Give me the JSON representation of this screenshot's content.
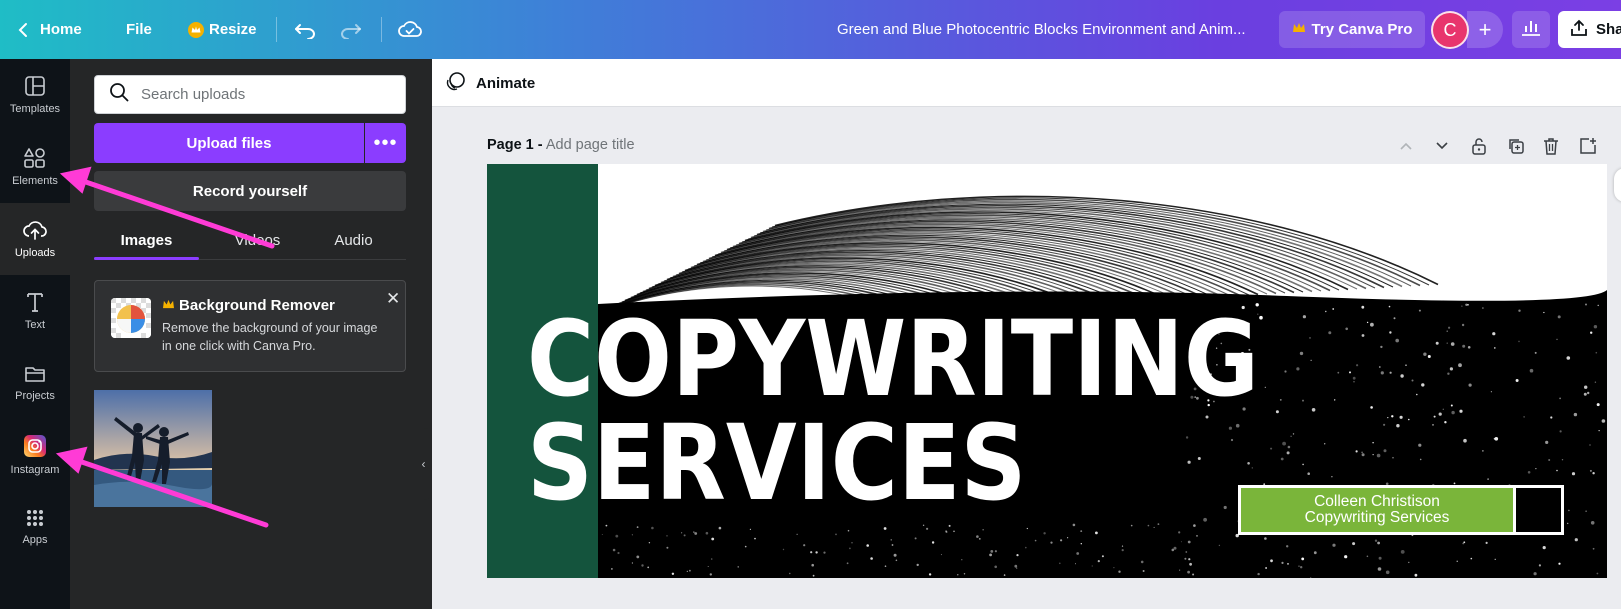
{
  "topbar": {
    "home_label": "Home",
    "file_label": "File",
    "resize_label": "Resize",
    "doc_title": "Green and Blue Photocentric Blocks Environment and Anim...",
    "try_pro_label": "Try Canva Pro",
    "avatar_initial": "C",
    "share_label": "Sha",
    "crown_color": "#f5b100"
  },
  "rail": {
    "items": [
      {
        "label": "Templates",
        "icon": "templates-icon"
      },
      {
        "label": "Elements",
        "icon": "elements-icon"
      },
      {
        "label": "Uploads",
        "icon": "upload-cloud-icon"
      },
      {
        "label": "Text",
        "icon": "text-icon"
      },
      {
        "label": "Projects",
        "icon": "folder-icon"
      },
      {
        "label": "Instagram",
        "icon": "instagram-icon"
      },
      {
        "label": "Apps",
        "icon": "apps-grid-icon"
      }
    ],
    "active_index": 2
  },
  "panel": {
    "search_placeholder": "Search uploads",
    "upload_label": "Upload files",
    "record_label": "Record yourself",
    "tabs": [
      {
        "label": "Images",
        "active": true
      },
      {
        "label": "Videos",
        "active": false
      },
      {
        "label": "Audio",
        "active": false
      }
    ],
    "promo": {
      "title": "Background Remover",
      "description": "Remove the background of your image in one click with Canva Pro."
    }
  },
  "editor": {
    "animate_label": "Animate",
    "page_label": "Page 1 -",
    "page_title_placeholder": "Add page title"
  },
  "design": {
    "headline_line1": "COPYWRITING",
    "headline_line2": "SERVICES",
    "name_line1": "Colleen Christison",
    "name_line2": "Copywriting Services",
    "green_band_color": "#14543d",
    "name_box_color": "#7ab53a"
  },
  "colors": {
    "accent": "#8b3dff",
    "annotation_arrow": "#ff3bd6"
  }
}
